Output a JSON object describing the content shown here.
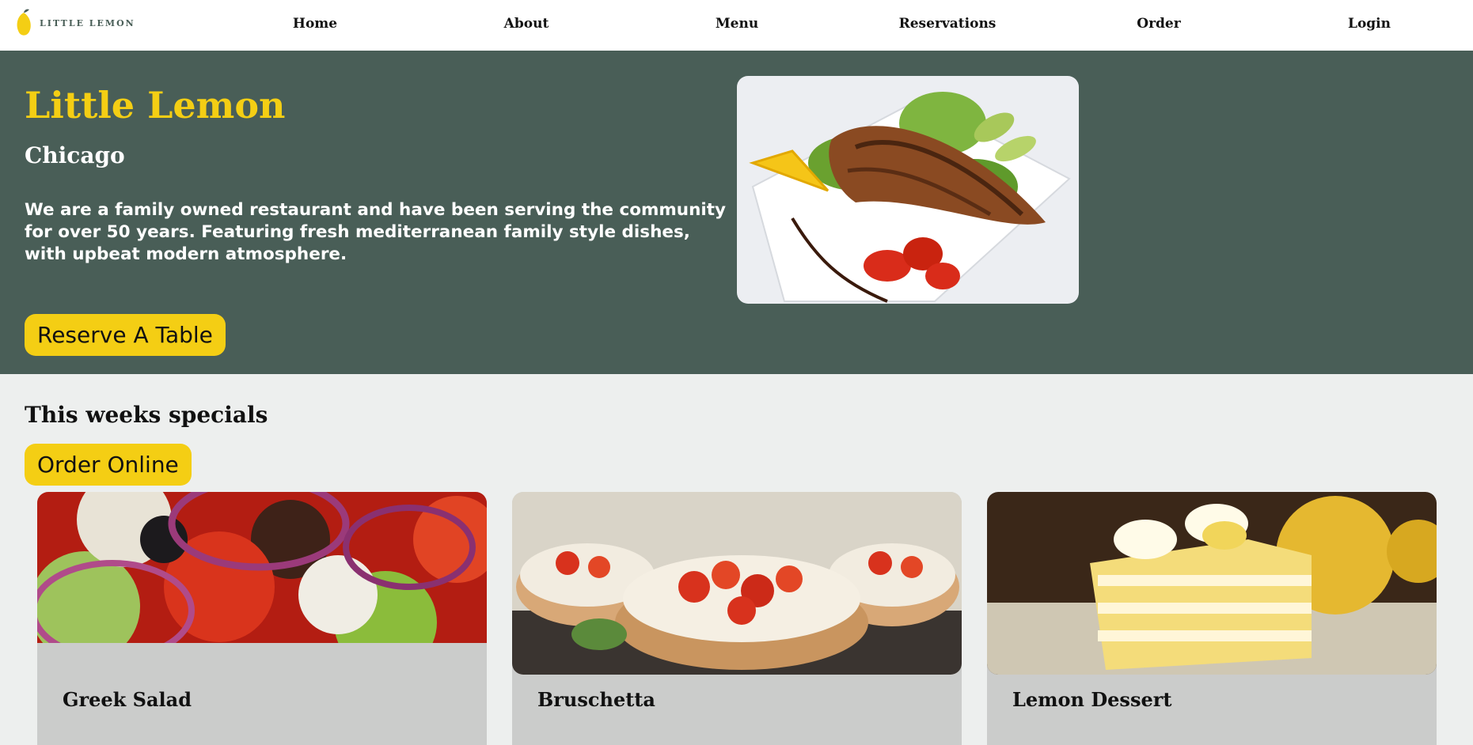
{
  "brand": {
    "logo_text": "LITTLE LEMON"
  },
  "nav": {
    "items": [
      {
        "label": "Home"
      },
      {
        "label": "About"
      },
      {
        "label": "Menu"
      },
      {
        "label": "Reservations"
      },
      {
        "label": "Order"
      },
      {
        "label": "Login"
      }
    ]
  },
  "hero": {
    "title": "Little Lemon",
    "subtitle": "Chicago",
    "description": "We are a family owned restaurant and have been serving the community for over 50 years. Featuring fresh mediterranean family style dishes, with upbeat modern atmosphere.",
    "cta_label": "Reserve A Table",
    "image_icon": "grilled-salmon-plate-image"
  },
  "specials": {
    "title": "This weeks specials",
    "order_label": "Order Online",
    "cards": [
      {
        "name": "Greek Salad",
        "image_icon": "greek-salad-image"
      },
      {
        "name": "Bruschetta",
        "image_icon": "bruschetta-image"
      },
      {
        "name": "Lemon Dessert",
        "image_icon": "lemon-cake-image"
      }
    ]
  },
  "colors": {
    "primary_green": "#495e57",
    "primary_yellow": "#f4ce14",
    "background": "#edefee",
    "card": "#cbcccb"
  }
}
